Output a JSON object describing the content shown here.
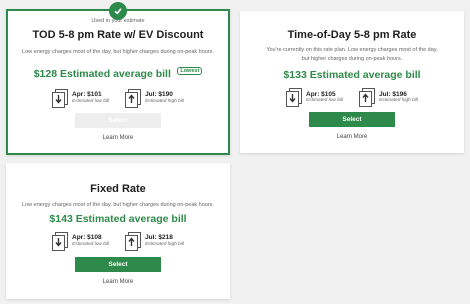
{
  "cards": [
    {
      "title": "TOD 5-8 pm Rate w/ EV Discount",
      "used_label": "Used in your estimate",
      "description": "Low energy charges most of the day, but higher charges during on-peak hours.",
      "estimate": "$128 Estimated average bill",
      "badge": "Lowest",
      "low_bill": "Apr: $101",
      "low_label": "Estimated low bill",
      "high_bill": "Jul: $190",
      "high_label": "Estimated high bill",
      "select_label": "Select",
      "learn_more": "Learn More"
    },
    {
      "title": "Time-of-Day 5-8 pm Rate",
      "description": "You're currently on this rate plan. Low energy charges most of the day, but higher charges during on-peak hours.",
      "estimate": "$133 Estimated average bill",
      "low_bill": "Apr: $105",
      "low_label": "Estimated low bill",
      "high_bill": "Jul: $196",
      "high_label": "Estimated high bill",
      "select_label": "Select",
      "learn_more": "Learn More"
    },
    {
      "title": "Fixed Rate",
      "description": "Low energy charges most of the day, but higher charges during on-peak hours.",
      "estimate": "$143 Estimated average bill",
      "low_bill": "Apr: $108",
      "low_label": "Estimated low bill",
      "high_bill": "Jul: $218",
      "high_label": "Estimated high bill",
      "select_label": "Select",
      "learn_more": "Learn More"
    }
  ],
  "colors": {
    "accent": "#2e8a4a",
    "background": "#f1f1f1"
  },
  "icons": {
    "low": "bill-down-arrow-icon",
    "high": "bill-up-arrow-icon",
    "used": "checkmark-icon"
  }
}
